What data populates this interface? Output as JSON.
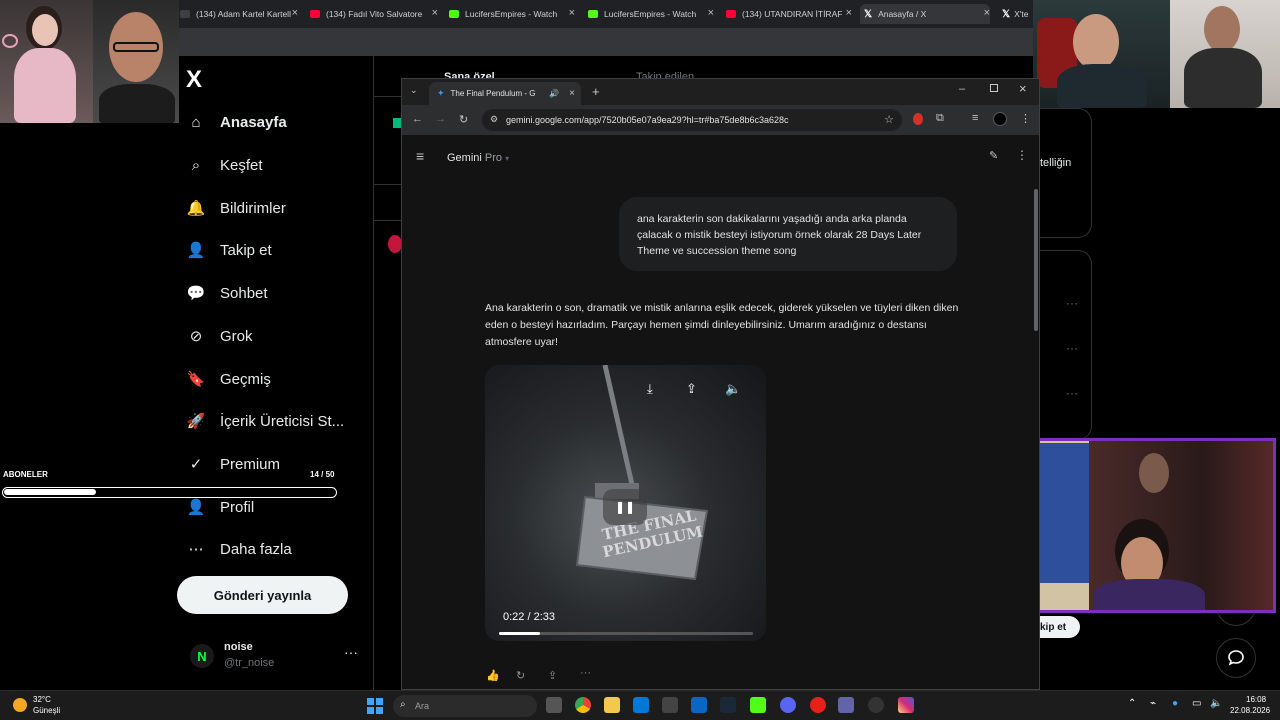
{
  "outer_tabs": [
    {
      "label": "(134) Adam Kartel Kartell",
      "icon": "generic-favicon",
      "color": "#9aa0a6"
    },
    {
      "label": "(134) Fadıl Vito Salvatore",
      "icon": "youtube-icon",
      "color": "#ff0033"
    },
    {
      "label": "LucifersEmpires - Watch",
      "icon": "kick-icon",
      "color": "#53fc18"
    },
    {
      "label": "LucifersEmpires - Watch",
      "icon": "kick-icon",
      "color": "#53fc18"
    },
    {
      "label": "(134) UTANDIRAN İTİRAF",
      "icon": "youtube-icon",
      "color": "#ff0033"
    },
    {
      "label": "Anasayfa / X",
      "icon": "x-icon",
      "color": "#ffffff"
    },
    {
      "label": "X'te",
      "icon": "x-icon",
      "color": "#ffffff"
    }
  ],
  "x_sidebar": {
    "logo": "X",
    "items": [
      {
        "label": "Anasayfa",
        "icon": "home-icon"
      },
      {
        "label": "Keşfet",
        "icon": "search-icon"
      },
      {
        "label": "Bildirimler",
        "icon": "bell-icon"
      },
      {
        "label": "Takip et",
        "icon": "follow-icon"
      },
      {
        "label": "Sohbet",
        "icon": "chat-icon"
      },
      {
        "label": "Grok",
        "icon": "grok-icon"
      },
      {
        "label": "Geçmiş",
        "icon": "bookmark-icon"
      },
      {
        "label": "İçerik Üreticisi St...",
        "icon": "rocket-icon"
      },
      {
        "label": "Premium",
        "icon": "verified-icon"
      },
      {
        "label": "Profil",
        "icon": "profile-icon"
      },
      {
        "label": "Daha fazla",
        "icon": "more-circle-icon"
      }
    ],
    "post_button": "Gönderi yayınla",
    "account": {
      "avatar_letter": "N",
      "name": "noise",
      "handle": "@tr_noise",
      "more": "···"
    }
  },
  "subscribers": {
    "label": "ABONELER",
    "count": "14 / 50",
    "progress": 0.28
  },
  "background_x": {
    "tab_for_you": "Sana özel",
    "tab_following": "Takip edilen",
    "right_text": "telliğin",
    "follow_chip": "kip et"
  },
  "inner_browser": {
    "tab_title": "The Final Pendulum - G",
    "url": "gemini.google.com/app/7520b05e07a9ea29?hl=tr#ba75de8b6c3a628c",
    "gemini_label": "Gemini",
    "gemini_tier": "Pro",
    "user_prompt": "ana karakterin son dakikalarını yaşadığı anda arka planda çalacak o mistik besteyi istiyorum örnek olarak 28 Days Later Theme ve succession theme song",
    "reply": "Ana karakterin o son, dramatik ve mistik anlarına eşlik edecek, giderek yükselen ve tüyleri diken diken eden o besteyi hazırladım. Parçayı hemen şimdi dinleyebilirsiniz. Umarım aradığınız o destansı atmosfere uyar!",
    "player": {
      "art_text": "THE FINAL PENDULUM",
      "time": "0:22 / 2:33",
      "progress": 0.16
    }
  },
  "taskbar": {
    "weather_temp": "32°C",
    "weather_desc": "Güneşli",
    "search_placeholder": "Ara",
    "time": "16:08",
    "date": "22.08.2026"
  }
}
